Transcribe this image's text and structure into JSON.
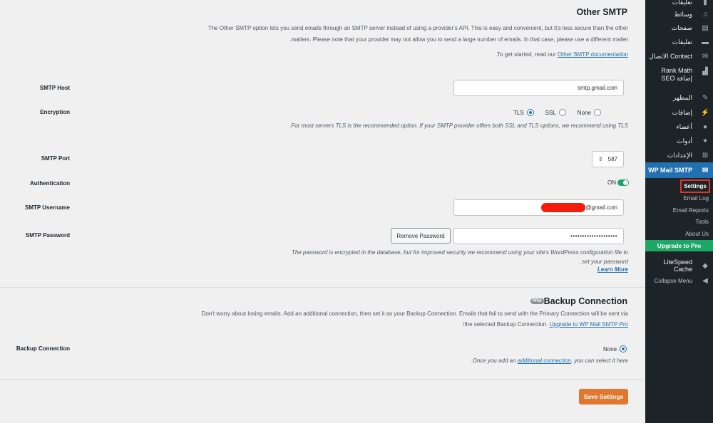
{
  "sidebar": {
    "items_top": [
      {
        "label": "تعليقات",
        "icon": "comment-icon"
      },
      {
        "label": "وسائط",
        "icon": "media-icon"
      },
      {
        "label": "صفحات",
        "icon": "pages-icon"
      },
      {
        "label": "تعليقات",
        "icon": "comments-icon"
      },
      {
        "label": "Contact الاتصال",
        "icon": "mail-icon"
      },
      {
        "label": "Rank Math إضافة SEO",
        "icon": "chart-icon"
      },
      {
        "label": "المظهر",
        "icon": "brush-icon"
      },
      {
        "label": "إضافات",
        "icon": "plugin-icon"
      },
      {
        "label": "أعضاء",
        "icon": "user-icon"
      },
      {
        "label": "أدوات",
        "icon": "wrench-icon"
      },
      {
        "label": "الإعدادات",
        "icon": "settings-icon"
      }
    ],
    "current": {
      "label": "WP Mail SMTP",
      "icon": "envelope-icon"
    },
    "submenu": {
      "settings": "Settings",
      "email_log": "Email Log",
      "email_reports": "Email Reports",
      "tools": "Tools",
      "about_us": "About Us"
    },
    "upgrade": "Upgrade to Pro",
    "litespeed": {
      "label": "LiteSpeed Cache",
      "icon": "diamond-icon"
    },
    "collapse": {
      "label": "Collapse Menu",
      "icon": "collapse-icon"
    }
  },
  "other_smtp": {
    "heading": "Other SMTP",
    "description": "The Other SMTP option lets you send emails through an SMTP server instead of using a provider's API. This is easy and convenient, but it's less secure than the other mailers. Please note that your provider may not allow you to send a large number of emails. In that case, please use a different mailer.",
    "get_started_prefix": "To get started, read our ",
    "get_started_link": "Other SMTP documentation",
    "get_started_suffix": "."
  },
  "fields": {
    "smtp_host": {
      "label": "SMTP Host",
      "value": "smtp.gmail.com"
    },
    "encryption": {
      "label": "Encryption",
      "options": [
        "None",
        "SSL",
        "TLS"
      ],
      "selected": "TLS",
      "help": "For most servers TLS is the recommended option. If your SMTP provider offers both SSL and TLS options, we recommend using TLS."
    },
    "smtp_port": {
      "label": "SMTP Port",
      "value": "587"
    },
    "authentication": {
      "label": "Authentication",
      "state": "ON"
    },
    "smtp_username": {
      "label": "SMTP Username",
      "value_suffix": "@gmail.com"
    },
    "smtp_password": {
      "label": "SMTP Password",
      "value": "••••••••••••••••••••",
      "remove_button": "Remove Password",
      "help": "The password is encrypted in the database, but for improved security we recommend using your site's WordPress configuration file to set your password.",
      "learn_more": "Learn More"
    }
  },
  "backup": {
    "badge": "PRO",
    "heading": "Backup Connection",
    "description": "Don't worry about losing emails. Add an additional connection, then set it as your Backup Connection. Emails that fail to send with the Primary Connection will be sent via the selected Backup Connection. ",
    "upgrade_link": "Upgrade to WP Mail SMTP Pro",
    "upgrade_suffix": "!",
    "field_label": "Backup Connection",
    "option": "None",
    "help_prefix": "Once you add an ",
    "help_link": "additional connection",
    "help_suffix": ", you can select it here."
  },
  "save_button": "Save Settings"
}
